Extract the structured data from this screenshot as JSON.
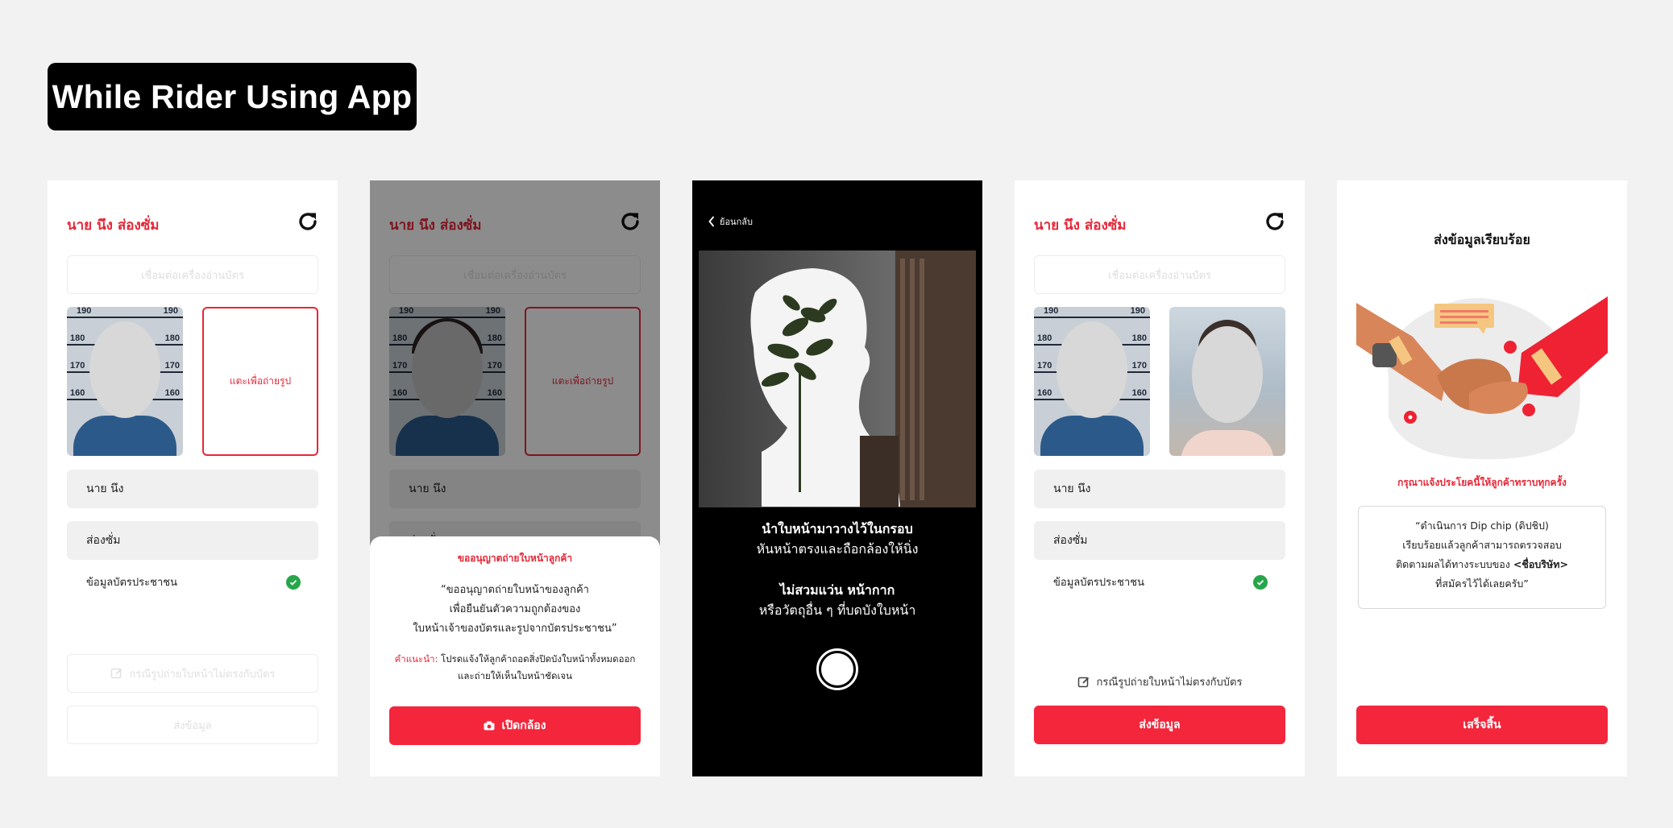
{
  "page": {
    "title": "While Rider Using App"
  },
  "common": {
    "rider_name": "นาย นึง ส่องซั่ม",
    "reader_button": "เชื่อมต่อเครื่องอ่านบัตร",
    "tap_photo": "แตะเพื่อถ่ายรูป",
    "first_name": "นาย นึง",
    "last_name": "ส่องซั่ม",
    "id_card_info": "ข้อมูลบัตรประชาชน",
    "face_mismatch_link": "กรณีรูปถ่ายใบหน้าไม่ตรงกับบัตร",
    "submit_button": "ส่งข้อมูล",
    "mug_numbers": [
      "190",
      "190",
      "180",
      "180",
      "170",
      "170",
      "160",
      "160"
    ]
  },
  "consent_sheet": {
    "title": "ขออนุญาตถ่ายใบหน้าลูกค้า",
    "body_line1": "“ขออนุญาตถ่ายใบหน้าของลูกค้า",
    "body_line2": "เพื่อยืนยันตัวความถูกต้องของ",
    "body_line3": "ใบหน้าเจ้าของบัตรและรูปจากบัตรประชาชน”",
    "tip_label": "คำแนะนำ:",
    "tip_line1": " โปรดแจ้งให้ลูกค้าถอดสิ่งปิดบังใบหน้าทั้งหมดออก",
    "tip_line2": "และถ่ายให้เห็นใบหน้าชัดเจน",
    "open_camera_button": "เปิดกล้อง"
  },
  "camera": {
    "back": "ย้อนกลับ",
    "line1_bold": "นำใบหน้ามาวางไว้ในกรอบ",
    "line2": "หันหน้าตรงและถือกล้องให้นิ่ง",
    "line3_bold": "ไม่สวมแว่น หน้ากาก",
    "line4": "หรือวัตถุอื่น ๆ ที่บดบังใบหน้า"
  },
  "success": {
    "title": "ส่งข้อมูลเรียบร้อย",
    "notice": "กรุณาแจ้งประโยคนี้ให้ลูกค้าทราบทุกครั้ง",
    "msg_line1": "“ดำเนินการ Dip chip (ดิปชิป)",
    "msg_line2": "เรียบร้อยแล้วลูกค้าสามารถตรวจสอบ",
    "msg_line3": "ติดตามผลได้ทางระบบของ ",
    "msg_company": "<ชื่อบริษัท>",
    "msg_line4": "ที่สมัครไว้ได้เลยครับ”",
    "finish_button": "เสร็จสิ้น"
  },
  "colors": {
    "accent": "#f3263c",
    "accent_text": "#e62737",
    "success": "#27a54a",
    "background": "#f2f2f2"
  }
}
